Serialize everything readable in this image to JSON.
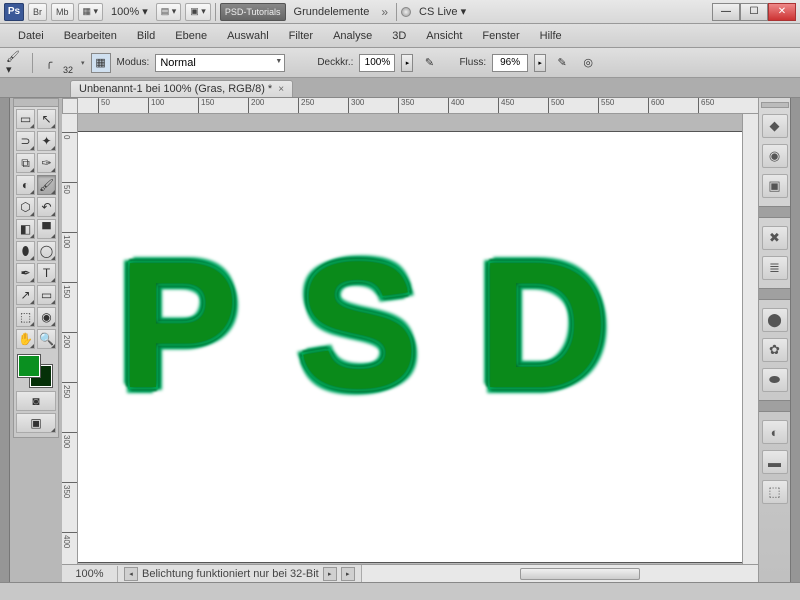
{
  "titlebar": {
    "ps": "Ps",
    "br": "Br",
    "mb": "Mb",
    "zoom": "100%",
    "workspace_active": "PSD-Tutorials",
    "workspace_other": "Grundelemente",
    "cslive": "CS Live"
  },
  "menu": [
    "Datei",
    "Bearbeiten",
    "Bild",
    "Ebene",
    "Auswahl",
    "Filter",
    "Analyse",
    "3D",
    "Ansicht",
    "Fenster",
    "Hilfe"
  ],
  "options": {
    "brush_size": "32",
    "mode_label": "Modus:",
    "mode_value": "Normal",
    "opacity_label": "Deckkr.:",
    "opacity_value": "100%",
    "flow_label": "Fluss:",
    "flow_value": "96%"
  },
  "doc_tab": {
    "title": "Unbenannt-1 bei 100% (Gras, RGB/8) *"
  },
  "ruler_h": [
    "50",
    "100",
    "150",
    "200",
    "250",
    "300",
    "350",
    "400",
    "450",
    "500",
    "550",
    "600",
    "650"
  ],
  "ruler_v": [
    "0",
    "5",
    "1",
    "1",
    "2",
    "2",
    "3",
    "3",
    "4"
  ],
  "ruler_v_labels": [
    "0",
    "50",
    "100",
    "150",
    "200",
    "250",
    "300",
    "350",
    "400"
  ],
  "canvas_text": "PSD",
  "statusbar": {
    "zoom": "100%",
    "msg": "Belichtung funktioniert nur bei 32-Bit"
  },
  "colors": {
    "foreground": "#0a9020",
    "background": "#053008"
  }
}
